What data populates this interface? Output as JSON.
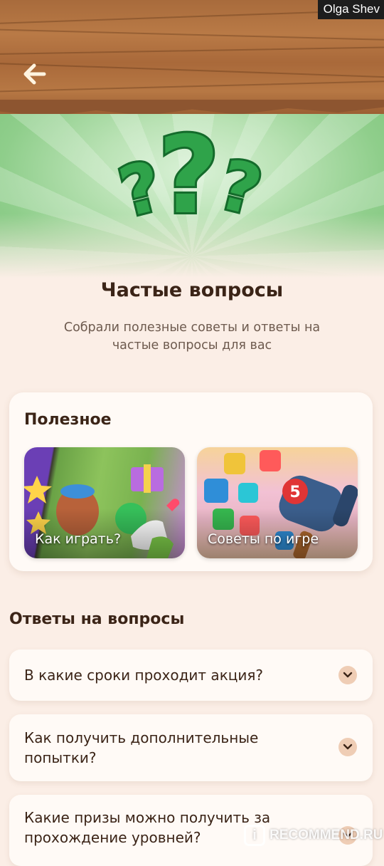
{
  "header": {
    "back_icon": "arrow-left-icon",
    "user_name": "Olga Shev"
  },
  "hero": {
    "icon": "question-marks-icon",
    "title": "Частые вопросы",
    "subtitle": "Собрали полезные советы и ответы на частые вопросы для вас"
  },
  "useful": {
    "heading": "Полезное",
    "tiles": [
      {
        "label": "Как играть?"
      },
      {
        "label": "Советы по игре"
      }
    ]
  },
  "faq": {
    "heading": "Ответы на вопросы",
    "items": [
      {
        "question": "В какие сроки проходит акция?"
      },
      {
        "question": "Как получить дополнительные попытки?"
      },
      {
        "question": "Какие призы можно получить за прохождение уровней?"
      }
    ],
    "chevron_icon": "chevron-down-icon"
  },
  "watermark": {
    "text": "RECOMMEND.RU"
  },
  "colors": {
    "background": "#fbeee6",
    "text": "#3b2417",
    "accent_green": "#2fa34a",
    "chevron_bg": "#efcdb5"
  }
}
